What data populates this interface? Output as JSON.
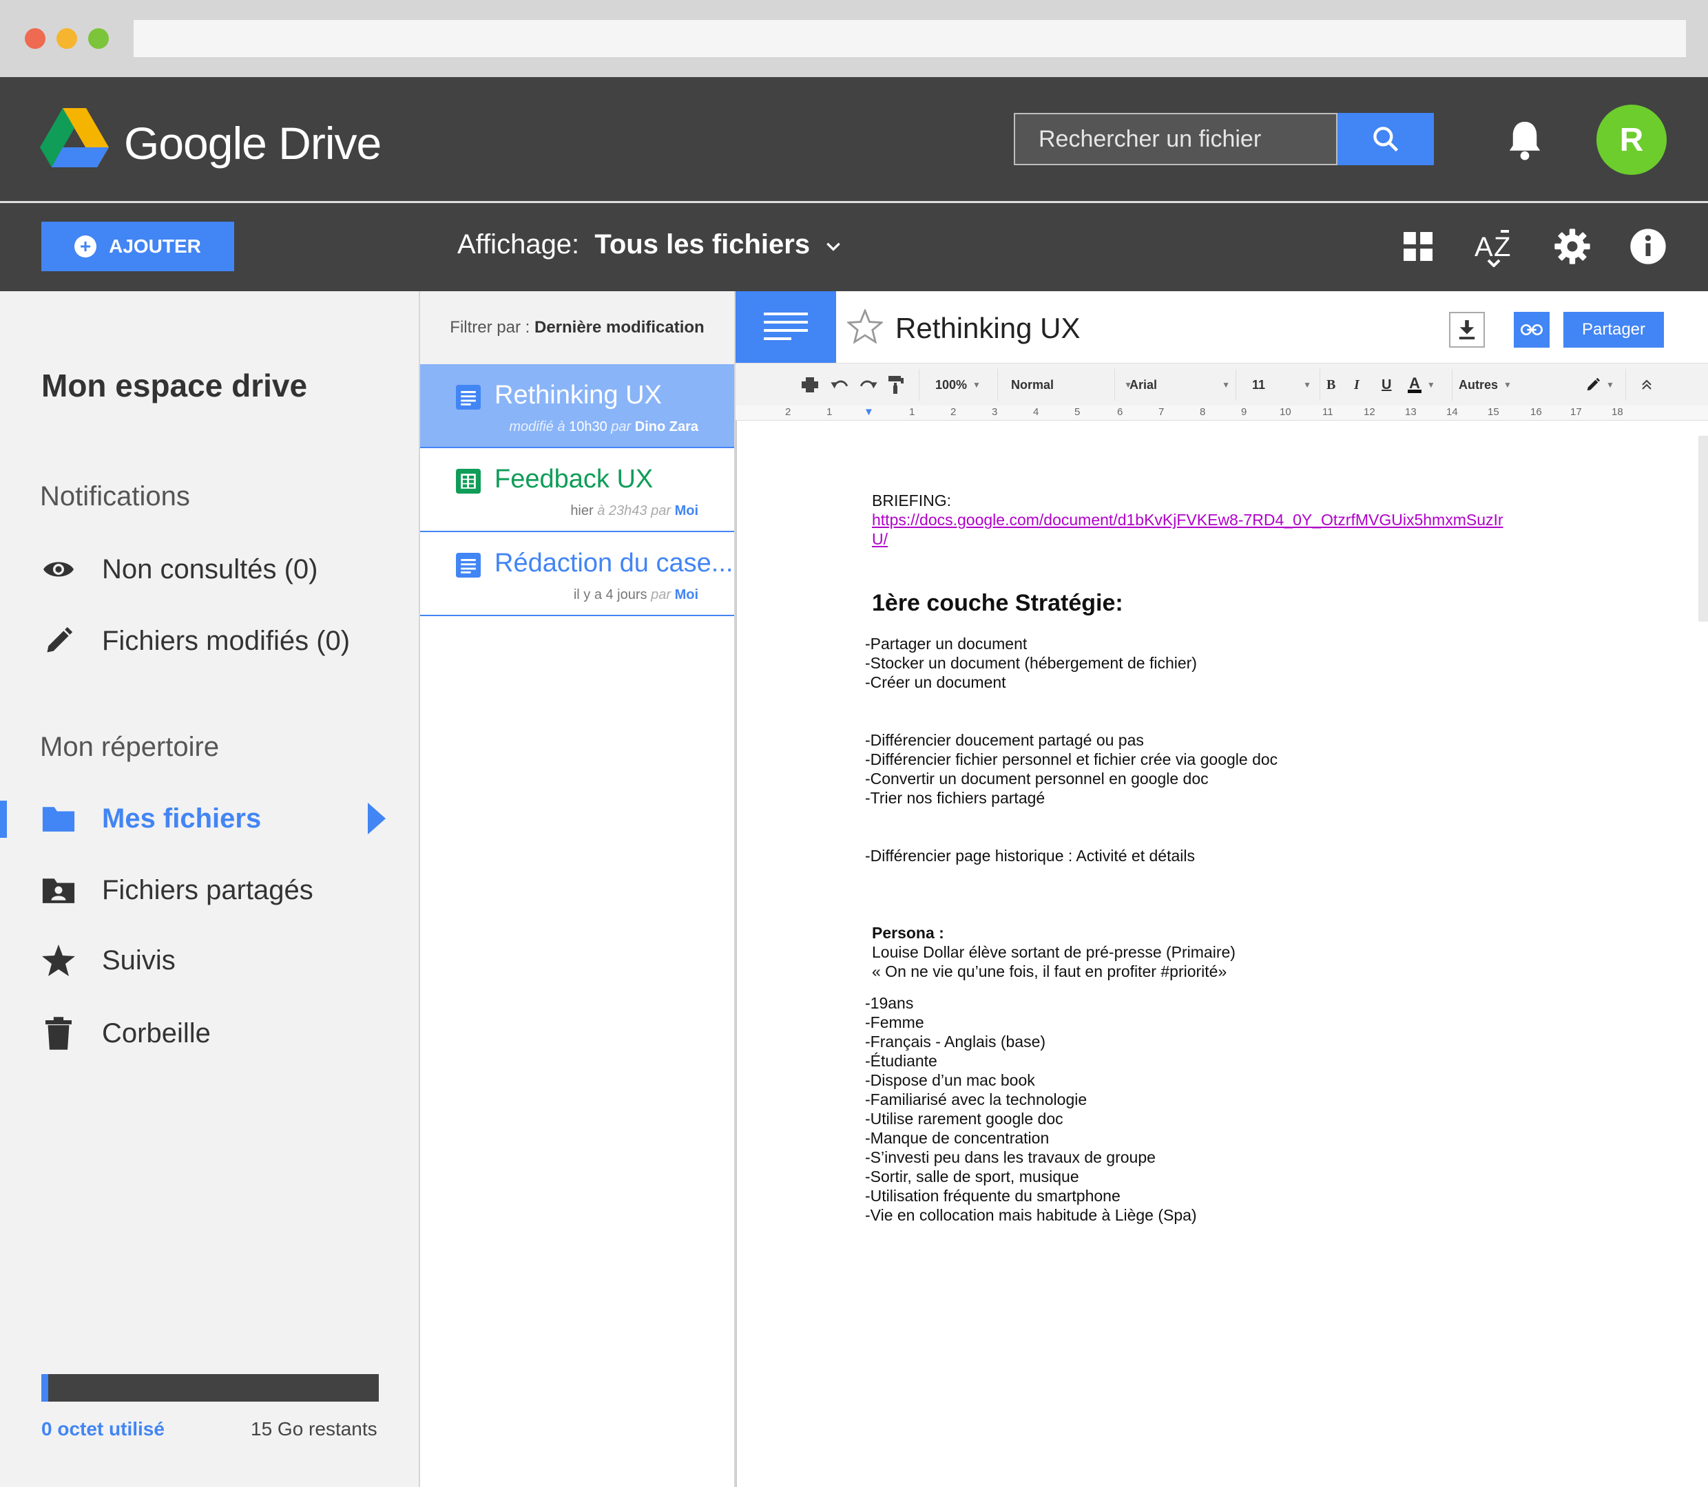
{
  "header": {
    "brand_google": "Google",
    "brand_product": "Drive",
    "search_placeholder": "Rechercher un fichier",
    "avatar_letter": "R"
  },
  "toolbar": {
    "add_label": "AJOUTER",
    "view_prefix": "Affichage:",
    "view_value": "Tous les fichiers"
  },
  "sidebar": {
    "title": "Mon espace drive",
    "notifications_heading": "Notifications",
    "notifications": [
      {
        "label": "Non consultés (0)",
        "icon": "eye-icon"
      },
      {
        "label": "Fichiers modifiés (0)",
        "icon": "pencil-icon"
      }
    ],
    "directory_heading": "Mon répertoire",
    "directory": [
      {
        "label": "Mes fichiers",
        "icon": "folder-icon",
        "active": true
      },
      {
        "label": "Fichiers partagés",
        "icon": "shared-folder-icon"
      },
      {
        "label": "Suivis",
        "icon": "star-icon"
      },
      {
        "label": "Corbeille",
        "icon": "trash-icon"
      }
    ],
    "storage": {
      "used": "0 octet utilisé",
      "remaining": "15 Go restants",
      "used_fraction": 0.02
    }
  },
  "filelist": {
    "filter_prefix": "Filtrer par :",
    "filter_value": "Dernière modification",
    "files": [
      {
        "name": "Rethinking UX",
        "when_prefix": "modifié à",
        "when": "10h30",
        "by_prefix": "par",
        "by": "Dino Zara",
        "type": "doc",
        "selected": true
      },
      {
        "name": "Feedback UX",
        "when_prefix": "hier",
        "when": "à 23h43",
        "by_prefix": "par",
        "by": "Moi",
        "type": "sheet"
      },
      {
        "name": "Rédaction du case...",
        "when_prefix": "il y a",
        "when": "4 jours",
        "by_prefix": "par",
        "by": "Moi",
        "type": "doc"
      }
    ]
  },
  "doc": {
    "title": "Rethinking UX",
    "share_label": "Partager",
    "format": {
      "zoom": "100%",
      "style": "Normal",
      "font": "Arial",
      "size": "11",
      "more": "Autres"
    },
    "ruler": [
      "2",
      "1",
      "1",
      "2",
      "3",
      "4",
      "5",
      "6",
      "7",
      "8",
      "9",
      "10",
      "11",
      "12",
      "13",
      "14",
      "15",
      "16",
      "17",
      "18"
    ],
    "briefing_label": "BRIEFING:",
    "briefing_link_1": "https://docs.google.com/document/d1bKvKjFVKEw8-7RD4_0Y_OtzrfMVGUix5hmxmSuzIr",
    "briefing_link_2": "U/",
    "heading": "1ère couche Stratégie:",
    "block1": "-Partager un document\n-Stocker un document (hébergement de fichier)\n-Créer un document",
    "block2": "-Différencier doucement partagé ou pas\n-Différencier fichier personnel et fichier crée via google doc\n-Convertir un document personnel en google doc\n-Trier nos fichiers partagé",
    "block3": "-Différencier page historique : Activité et détails",
    "persona_label": "Persona :",
    "persona_desc": "Louise Dollar élève sortant de pré-presse (Primaire)\n« On ne vie qu’une fois, il faut en profiter #priorité»",
    "block4": "-19ans\n-Femme\n-Français - Anglais (base)\n-Étudiante\n-Dispose d’un mac book\n-Familiarisé avec la technologie\n-Utilise rarement google doc\n-Manque de concentration\n-S’investi peu dans les travaux de groupe\n-Sortir, salle de sport, musique\n-Utilisation fréquente du smartphone\n-Vie en collocation mais habitude à Liège (Spa)"
  },
  "colors": {
    "accent": "#4285f4",
    "dark": "#424242",
    "green": "#0f9d58",
    "avatar": "#6ccd2d"
  }
}
